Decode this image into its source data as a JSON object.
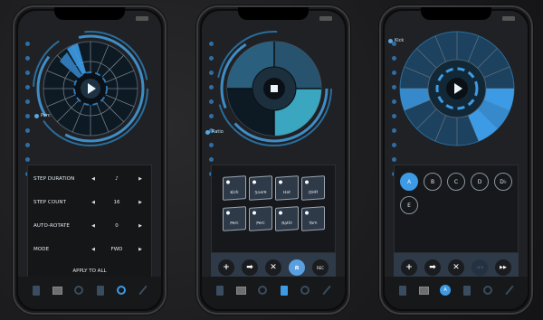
{
  "screen1": {
    "track_label": "Perc",
    "settings": [
      {
        "label": "STEP DURATION",
        "value": "♪"
      },
      {
        "label": "STEP COUNT",
        "value": "16"
      },
      {
        "label": "AUTO-ROTATE",
        "value": "0"
      },
      {
        "label": "MODE",
        "value": "FWD"
      }
    ],
    "apply_label": "APPLY TO ALL"
  },
  "screen2": {
    "track_label": "Ratio",
    "pads": [
      "Kick",
      "Snare",
      "Hat",
      "OHH",
      "Perc",
      "Perc",
      "Ratio",
      "Tom"
    ],
    "actions": {
      "add": "+",
      "next": "➡",
      "close": "✕",
      "record": "REC"
    }
  },
  "screen3": {
    "track_label": "Kick",
    "patterns": [
      "A",
      "B",
      "C",
      "D",
      "D♭",
      "E"
    ],
    "actions": {
      "add": "+",
      "next": "➡",
      "close": "✕",
      "rewind": "◀◀",
      "forward": "▶▶"
    },
    "tab_active_label": "A"
  },
  "colors": {
    "accent": "#3d9be6",
    "panel": "#16181b",
    "dial_fill": "#2a5f7e"
  }
}
